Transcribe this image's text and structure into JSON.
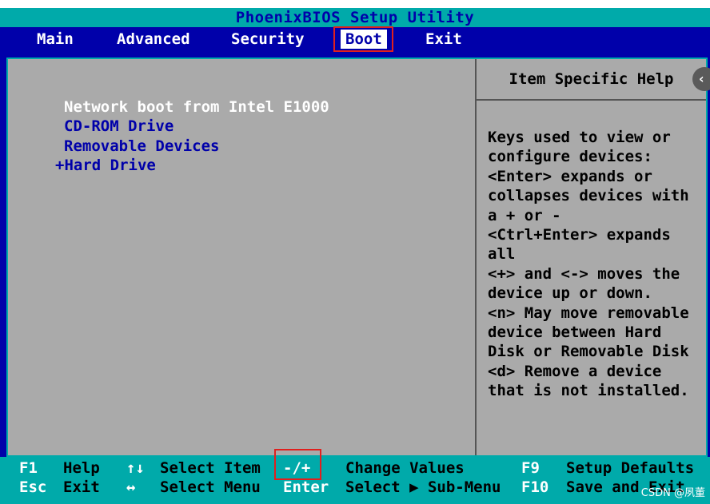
{
  "title": "PhoenixBIOS Setup Utility",
  "menu": [
    {
      "label": "Main"
    },
    {
      "label": "Advanced"
    },
    {
      "label": "Security"
    },
    {
      "label": "Boot",
      "active": true
    },
    {
      "label": "Exit"
    }
  ],
  "boot_items": [
    {
      "label": "Network boot from Intel E1000",
      "selected": true
    },
    {
      "label": "CD-ROM Drive"
    },
    {
      "label": "Removable Devices"
    },
    {
      "label": "+Hard Drive"
    }
  ],
  "help": {
    "title": "Item Specific Help",
    "text": "Keys used to view or\nconfigure devices:\n<Enter> expands or\ncollapses devices with\na + or -\n<Ctrl+Enter> expands\nall\n<+> and <-> moves the\ndevice up or down.\n<n> May move removable\ndevice between Hard\nDisk or Removable Disk\n<d> Remove a device\nthat is not installed."
  },
  "status": {
    "row1": {
      "k1": "F1",
      "d1": "Help",
      "k2": "↑↓",
      "d2": "Select Item",
      "k3": "-/+",
      "d3": "Change Values",
      "k4": "F9",
      "d4": "Setup Defaults"
    },
    "row2": {
      "k1": "Esc",
      "d1": "Exit",
      "k2": "↔",
      "d2": "Select Menu",
      "k3": "Enter",
      "d3": "Select ▶ Sub-Menu",
      "k4": "F10",
      "d4": "Save and Exit"
    }
  },
  "overlay": {
    "scroll_icon": "chevron-left-icon",
    "scroll_glyph": "‹",
    "watermark": "CSDN @夙董"
  },
  "colors": {
    "bios_blue": "#0000aa",
    "bios_cyan": "#00aaaa",
    "bios_gray": "#aaaaaa",
    "annotation_red": "#e0201e"
  }
}
